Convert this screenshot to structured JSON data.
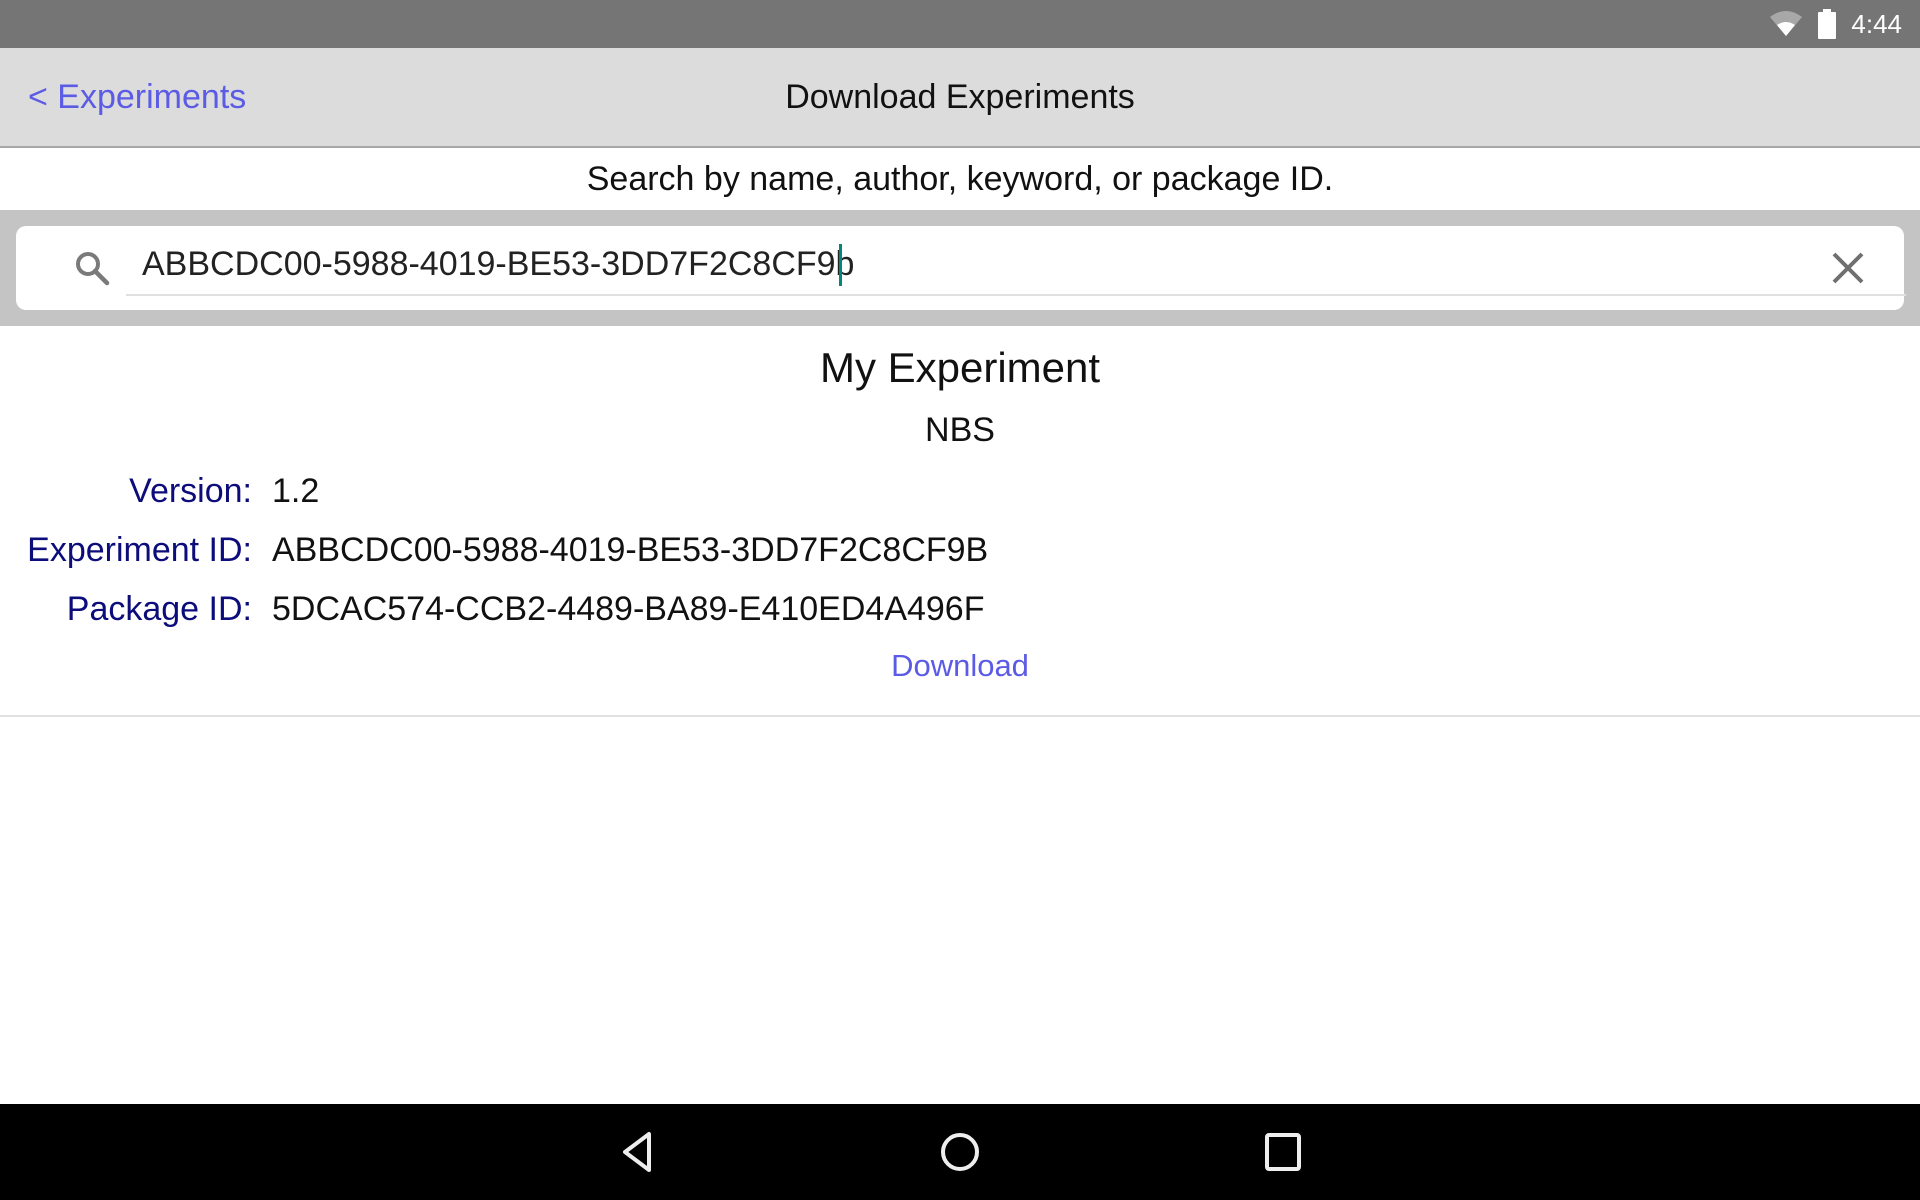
{
  "status_bar": {
    "time": "4:44",
    "icons": [
      "wifi-icon",
      "battery-icon"
    ]
  },
  "nav_bar": {
    "back_label": "< Experiments",
    "title": "Download Experiments"
  },
  "search": {
    "hint": "Search by name, author, keyword, or package ID.",
    "value": "ABBCDC00-5988-4019-BE53-3DD7F2C8CF9b",
    "search_icon": "search-icon",
    "clear_icon": "close-icon"
  },
  "result": {
    "title": "My Experiment",
    "author": "NBS",
    "fields": [
      {
        "label": "Version:",
        "value": "1.2"
      },
      {
        "label": "Experiment ID:",
        "value": "ABBCDC00-5988-4019-BE53-3DD7F2C8CF9B"
      },
      {
        "label": "Package ID:",
        "value": "5DCAC574-CCB2-4489-BA89-E410ED4A496F"
      }
    ],
    "download_label": "Download"
  },
  "system_nav": {
    "buttons": [
      "back-icon",
      "home-icon",
      "recents-icon"
    ]
  },
  "colors": {
    "link": "#5b5be6",
    "label": "#0c0c7a",
    "cursor": "#00897b",
    "navbar_bg": "#dcdcdc",
    "statusbar_bg": "#757575"
  }
}
